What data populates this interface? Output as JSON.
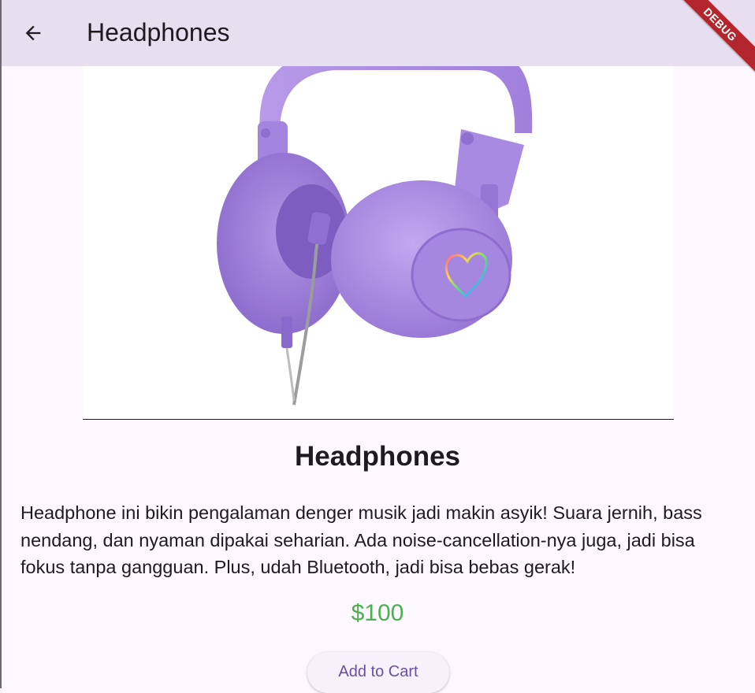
{
  "appbar": {
    "title": "Headphones",
    "back_icon": "arrow-left-icon",
    "debug_label": "DEBUG"
  },
  "product": {
    "image_icon": "headphones-image",
    "name": "Headphones",
    "description": "Headphone ini bikin pengalaman denger musik jadi makin asyik! Suara jernih, bass nendang, dan nyaman dipakai seharian. Ada noise-cancellation-nya juga, jadi bisa fokus tanpa gangguan. Plus, udah Bluetooth, jadi bisa bebas gerak!",
    "price": "$100",
    "add_to_cart_label": "Add to Cart"
  },
  "colors": {
    "appbar_bg": "#e7dff0",
    "page_bg": "#fdf7ff",
    "price": "#4caf50",
    "button_text": "#6750a4",
    "headphone_purple": "#a78be0",
    "debug_banner": "#b3262d"
  }
}
